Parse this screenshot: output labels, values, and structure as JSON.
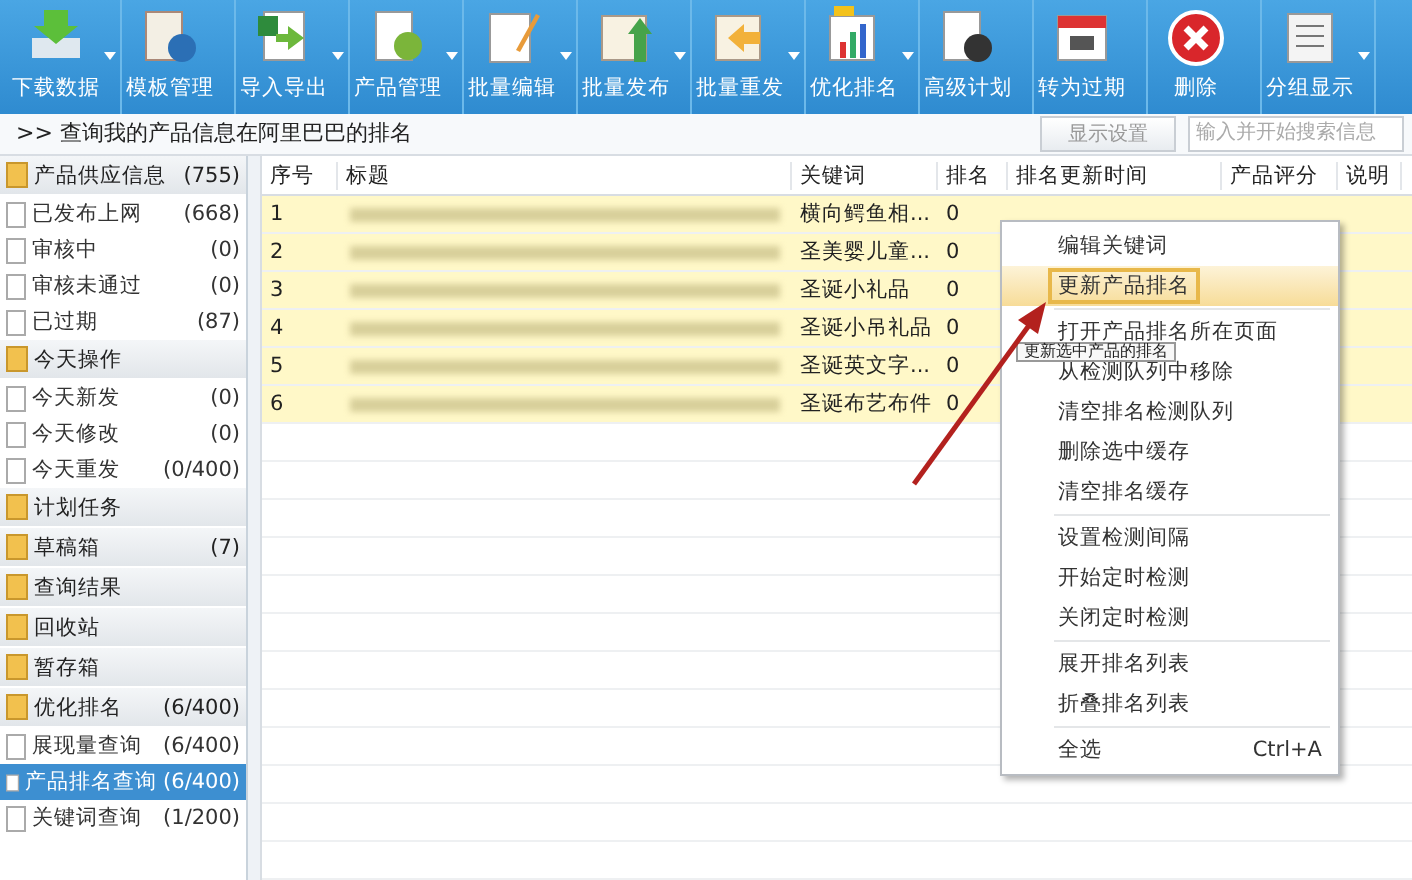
{
  "toolbar": [
    {
      "label": "下载数据",
      "has_dropdown": true
    },
    {
      "label": "模板管理",
      "has_dropdown": false
    },
    {
      "label": "导入导出",
      "has_dropdown": true
    },
    {
      "label": "产品管理",
      "has_dropdown": true
    },
    {
      "label": "批量编辑",
      "has_dropdown": true
    },
    {
      "label": "批量发布",
      "has_dropdown": true
    },
    {
      "label": "批量重发",
      "has_dropdown": true
    },
    {
      "label": "优化排名",
      "has_dropdown": true
    },
    {
      "label": "高级计划",
      "has_dropdown": false
    },
    {
      "label": "转为过期",
      "has_dropdown": false
    },
    {
      "label": "删除",
      "has_dropdown": false
    },
    {
      "label": "分组显示",
      "has_dropdown": true
    }
  ],
  "breadcrumb": ">> 查询我的产品信息在阿里巴巴的排名",
  "display_settings_button": "显示设置",
  "search": {
    "placeholder": "输入并开始搜索信息"
  },
  "sidebar": [
    {
      "label": "产品供应信息",
      "count": "(755)",
      "children": [
        {
          "label": "已发布上网",
          "count": "(668)",
          "selected": false
        },
        {
          "label": "审核中",
          "count": "(0)",
          "selected": false
        },
        {
          "label": "审核未通过",
          "count": "(0)",
          "selected": false
        },
        {
          "label": "已过期",
          "count": "(87)",
          "selected": false
        }
      ]
    },
    {
      "label": "今天操作",
      "children": [
        {
          "label": "今天新发",
          "count": "(0)",
          "selected": false
        },
        {
          "label": "今天修改",
          "count": "(0)",
          "selected": false
        },
        {
          "label": "今天重发",
          "count": "(0/400)",
          "selected": false
        }
      ]
    },
    {
      "label": "计划任务"
    },
    {
      "label": "草稿箱",
      "count": "(7)"
    },
    {
      "label": "查询结果"
    },
    {
      "label": "回收站"
    },
    {
      "label": "暂存箱"
    },
    {
      "label": "优化排名",
      "count": "(6/400)",
      "children": [
        {
          "label": "展现量查询",
          "count": "(6/400)",
          "selected": false
        },
        {
          "label": "产品排名查询",
          "count": "(6/400)",
          "selected": true
        },
        {
          "label": "关键词查询",
          "count": "(1/200)",
          "selected": false
        }
      ]
    }
  ],
  "table": {
    "columns": [
      "序号",
      "标题",
      "关键词",
      "排名",
      "排名更新时间",
      "产品评分",
      "说明"
    ],
    "rows": [
      {
        "no": "1",
        "keyword": "横向鳄鱼相...",
        "rank": "0"
      },
      {
        "no": "2",
        "keyword": "圣美婴儿童...",
        "rank": "0"
      },
      {
        "no": "3",
        "keyword": "圣诞小礼品",
        "rank": "0"
      },
      {
        "no": "4",
        "keyword": "圣诞小吊礼品",
        "rank": "0"
      },
      {
        "no": "5",
        "keyword": "圣诞英文字...",
        "rank": "0"
      },
      {
        "no": "6",
        "keyword": "圣诞布艺布件",
        "rank": "0"
      }
    ]
  },
  "context_menu": [
    {
      "label": "编辑关键词",
      "selected": false,
      "separator_before": false
    },
    {
      "label": "更新产品排名",
      "selected": true,
      "separator_before": false
    },
    {
      "label": "打开产品排名所在页面",
      "selected": false,
      "separator_before": true
    },
    {
      "label": "从检测队列中移除",
      "selected": false,
      "separator_before": false
    },
    {
      "label": "清空排名检测队列",
      "selected": false,
      "separator_before": false
    },
    {
      "label": "删除选中缓存",
      "selected": false,
      "separator_before": false
    },
    {
      "label": "清空排名缓存",
      "selected": false,
      "separator_before": false
    },
    {
      "label": "设置检测间隔",
      "selected": false,
      "separator_before": true
    },
    {
      "label": "开始定时检测",
      "selected": false,
      "separator_before": false
    },
    {
      "label": "关闭定时检测",
      "selected": false,
      "separator_before": false
    },
    {
      "label": "展开排名列表",
      "selected": false,
      "separator_before": true
    },
    {
      "label": "折叠排名列表",
      "selected": false,
      "separator_before": false
    },
    {
      "label": "全选",
      "shortcut": "Ctrl+A",
      "selected": false,
      "separator_before": true
    }
  ],
  "tooltip": "更新选中产品的排名"
}
